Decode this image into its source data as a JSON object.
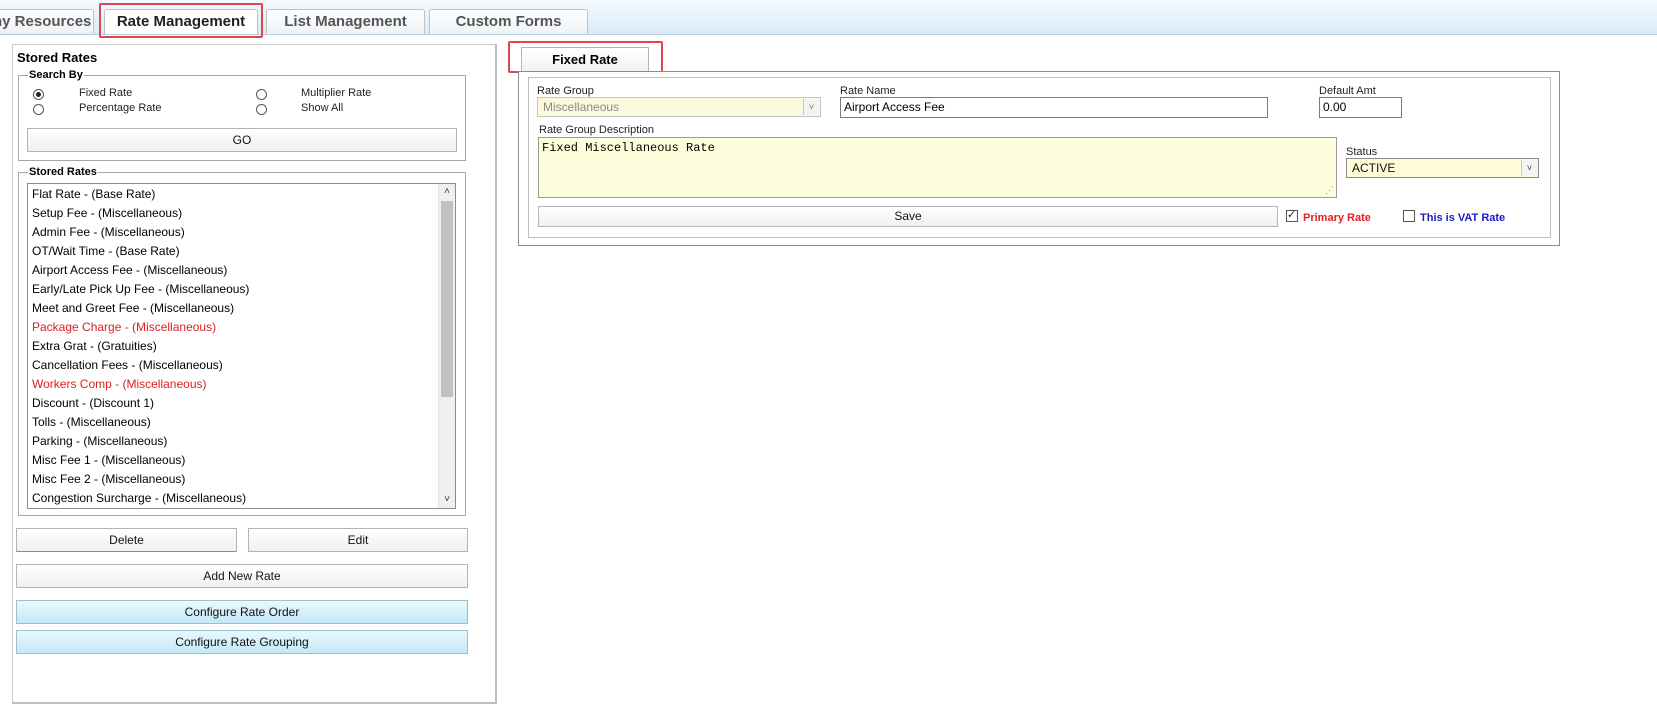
{
  "top_tabs": [
    {
      "label": "ny Resources",
      "active": false
    },
    {
      "label": "Rate Management",
      "active": true
    },
    {
      "label": "List Management",
      "active": false
    },
    {
      "label": "Custom Forms",
      "active": false
    }
  ],
  "left_panel": {
    "title": "Stored Rates",
    "search_by": {
      "legend": "Search By",
      "options": [
        {
          "label": "Fixed Rate",
          "checked": true
        },
        {
          "label": "Multiplier Rate",
          "checked": false
        },
        {
          "label": "Percentage Rate",
          "checked": false
        },
        {
          "label": "Show All",
          "checked": false
        }
      ],
      "go_label": "GO"
    },
    "stored_rates": {
      "legend": "Stored Rates",
      "items": [
        {
          "label": "Flat Rate - (Base Rate)",
          "color": "#000000"
        },
        {
          "label": "Setup Fee - (Miscellaneous)",
          "color": "#000000"
        },
        {
          "label": "Admin Fee - (Miscellaneous)",
          "color": "#000000"
        },
        {
          "label": "OT/Wait Time - (Base Rate)",
          "color": "#000000"
        },
        {
          "label": "Airport Access Fee - (Miscellaneous)",
          "color": "#000000"
        },
        {
          "label": "Early/Late Pick Up Fee - (Miscellaneous)",
          "color": "#000000"
        },
        {
          "label": "Meet and Greet Fee - (Miscellaneous)",
          "color": "#000000"
        },
        {
          "label": "Package Charge - (Miscellaneous)",
          "color": "#e02020"
        },
        {
          "label": "Extra Grat - (Gratuities)",
          "color": "#000000"
        },
        {
          "label": "Cancellation Fees - (Miscellaneous)",
          "color": "#000000"
        },
        {
          "label": "Workers Comp - (Miscellaneous)",
          "color": "#e02020"
        },
        {
          "label": "Discount - (Discount 1)",
          "color": "#000000"
        },
        {
          "label": "Tolls - (Miscellaneous)",
          "color": "#000000"
        },
        {
          "label": "Parking - (Miscellaneous)",
          "color": "#000000"
        },
        {
          "label": "Misc Fee 1 - (Miscellaneous)",
          "color": "#000000"
        },
        {
          "label": "Misc Fee 2 - (Miscellaneous)",
          "color": "#000000"
        },
        {
          "label": "Congestion Surcharge - (Miscellaneous)",
          "color": "#000000"
        }
      ]
    },
    "buttons": {
      "delete": "Delete",
      "edit": "Edit",
      "add_new_rate": "Add New Rate",
      "configure_rate_order": "Configure Rate Order",
      "configure_rate_grouping": "Configure Rate Grouping"
    }
  },
  "right_panel": {
    "tab_label": "Fixed Rate",
    "rate_group": {
      "label": "Rate Group",
      "value": "Miscellaneous"
    },
    "rate_name": {
      "label": "Rate Name",
      "value": "Airport Access Fee"
    },
    "default_amt": {
      "label": "Default Amt",
      "value": "0.00"
    },
    "rate_group_description": {
      "label": "Rate Group Description",
      "value": "Fixed Miscellaneous Rate"
    },
    "status": {
      "label": "Status",
      "value": "ACTIVE"
    },
    "save_label": "Save",
    "primary_rate": {
      "label": "Primary Rate",
      "checked": true,
      "color": "#e02020"
    },
    "vat_rate": {
      "label": "This is VAT Rate",
      "checked": false,
      "color": "#1a1acc"
    }
  },
  "colors": {
    "highlight": "#e0474c",
    "list_error": "#e02020"
  }
}
